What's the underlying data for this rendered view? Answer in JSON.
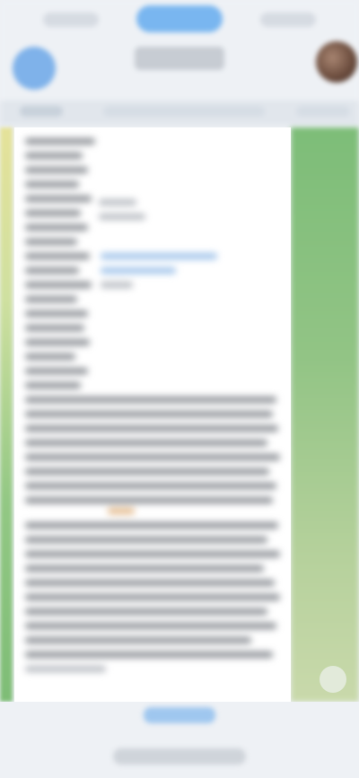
{
  "top_tabs": [
    {
      "name": "tab-left"
    },
    {
      "name": "tab-center"
    },
    {
      "name": "tab-right"
    }
  ],
  "header": {
    "left_icon": "menu-icon",
    "avatar": "avatar"
  },
  "document": {
    "note": ""
  },
  "colors": {
    "accent": "#79b6f0",
    "left_gradient_top": "#e5e29a",
    "left_gradient_bottom": "#7ebd76",
    "right_gradient_top": "#7dbd78",
    "right_gradient_bottom": "#c9d9ab",
    "doc_background": "#ffffff"
  }
}
